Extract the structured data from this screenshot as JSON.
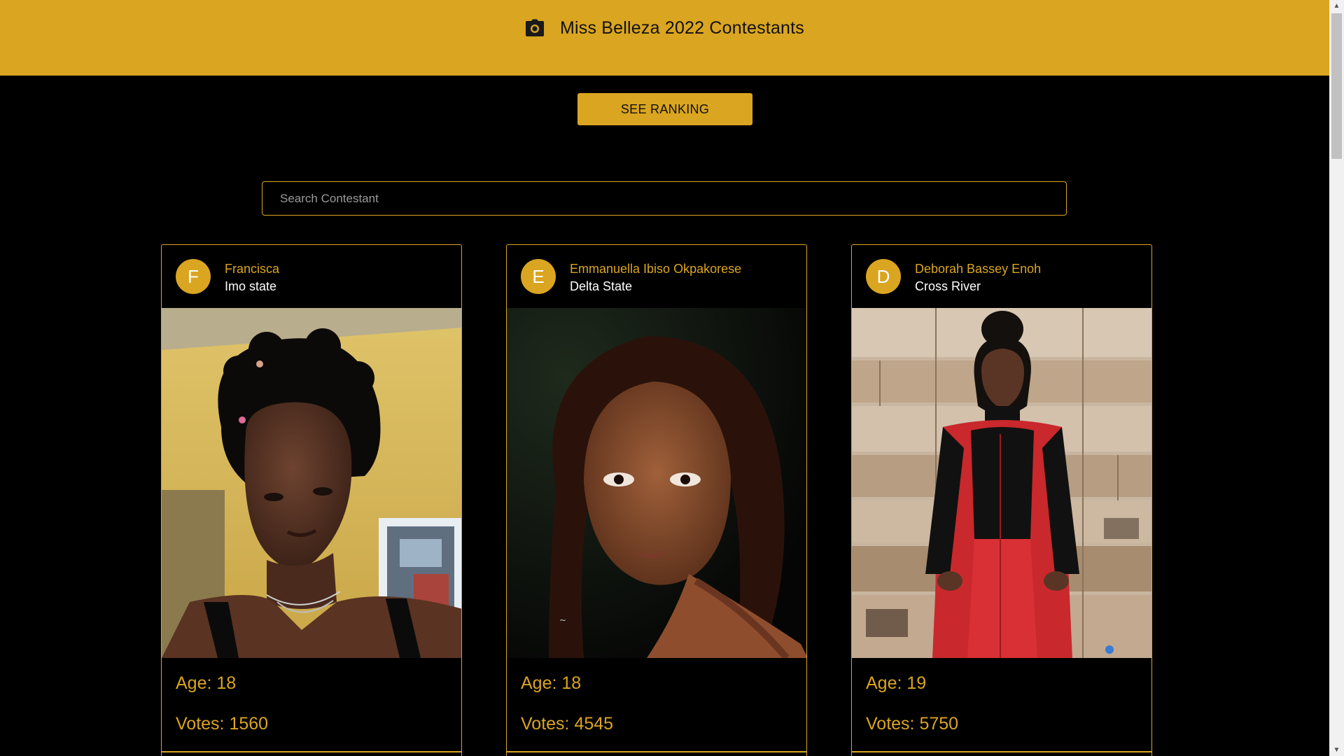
{
  "header": {
    "title": "Miss Belleza 2022 Contestants",
    "icon": "camera-icon",
    "background_color": "#DAA520"
  },
  "actions": {
    "ranking_label": "SEE RANKING"
  },
  "search": {
    "placeholder": "Search Contestant",
    "value": ""
  },
  "theme": {
    "accent": "#DAA520",
    "background": "#000000"
  },
  "contestants": [
    {
      "initial": "F",
      "name": "Francisca",
      "state": "Imo state",
      "age_label": "Age: 18",
      "votes_label": "Votes: 1560",
      "age": 18,
      "votes": 1560
    },
    {
      "initial": "E",
      "name": "Emmanuella Ibiso Okpakorese",
      "state": "Delta State",
      "age_label": "Age: 18",
      "votes_label": "Votes: 4545",
      "age": 18,
      "votes": 4545
    },
    {
      "initial": "D",
      "name": "Deborah Bassey Enoh",
      "state": "Cross River",
      "age_label": "Age: 19",
      "votes_label": "Votes: 5750",
      "age": 19,
      "votes": 5750
    }
  ]
}
